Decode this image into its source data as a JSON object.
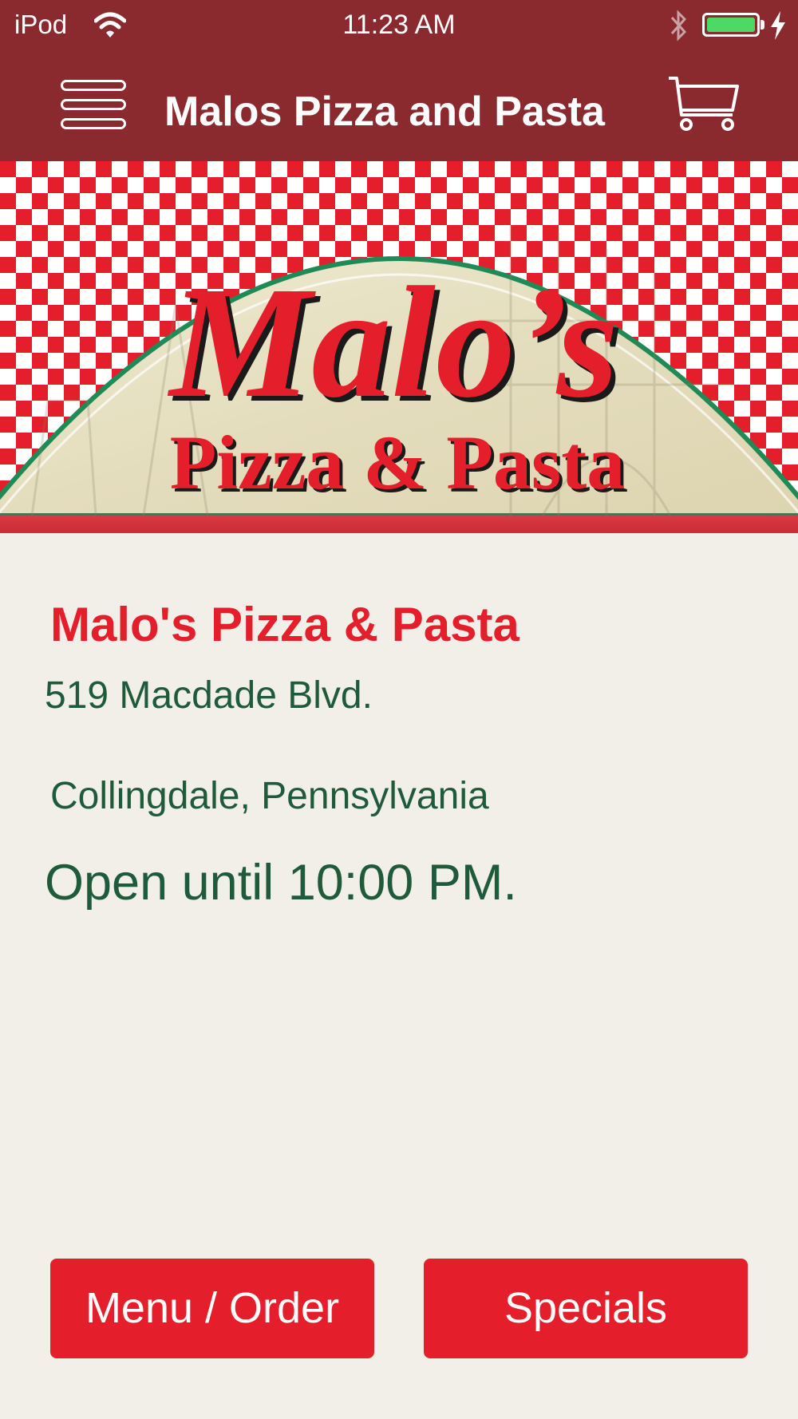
{
  "status_bar": {
    "device": "iPod",
    "time": "11:23 AM",
    "battery_color": "#4cd964"
  },
  "nav": {
    "title": "Malos Pizza and Pasta",
    "menu_icon": "hamburger-menu-icon",
    "cart_icon": "shopping-cart-icon",
    "background": "#8a2a2f"
  },
  "banner": {
    "logo_line1": "Malo’s",
    "logo_line2": "Pizza & Pasta",
    "checker_colors": [
      "#e41e2a",
      "#ffffff"
    ]
  },
  "restaurant": {
    "name": "Malo's Pizza & Pasta",
    "address": "519 Macdade Blvd.",
    "city": "Collingdale, Pennsylvania",
    "hours": "Open until 10:00 PM."
  },
  "actions": {
    "menu_order": "Menu / Order",
    "specials": "Specials"
  },
  "colors": {
    "accent_red": "#e41e2a",
    "text_green": "#1f5a3a",
    "page_bg": "#f1efe8"
  }
}
